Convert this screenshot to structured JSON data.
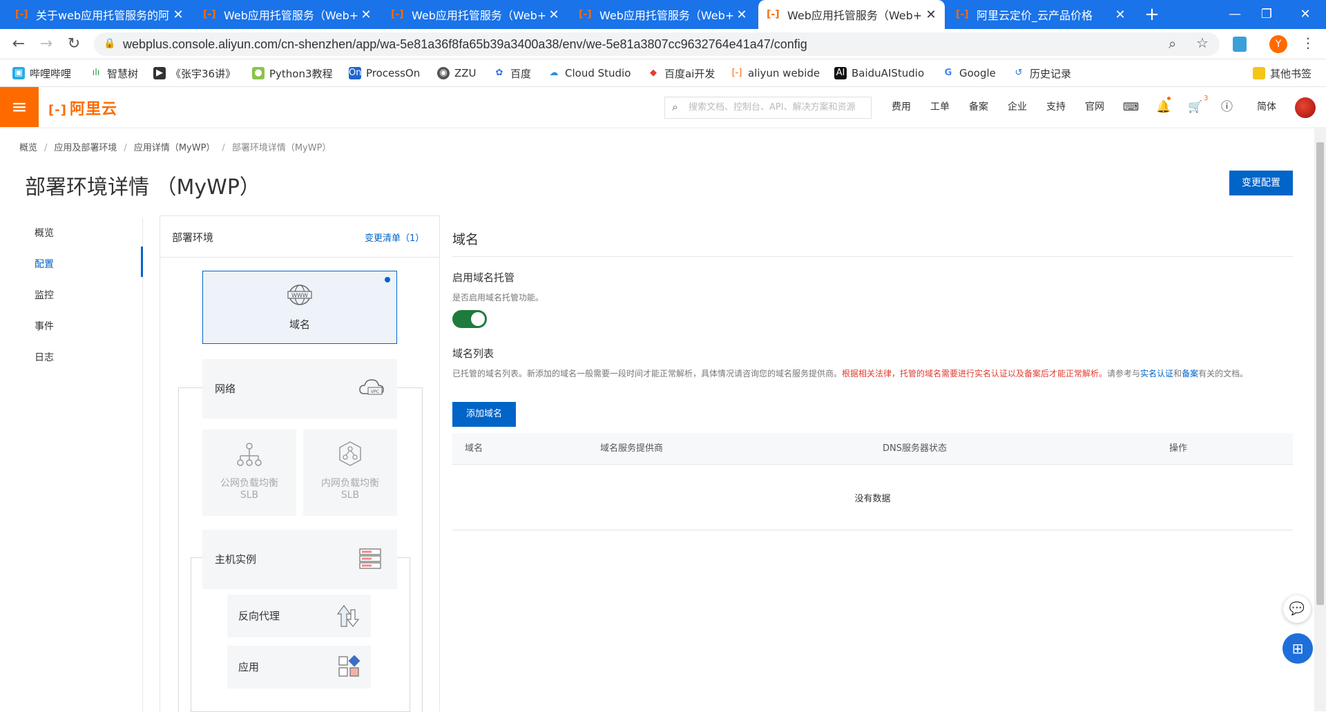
{
  "browser": {
    "tabs": [
      {
        "title": "关于web应用托管服务的阿里",
        "active": false
      },
      {
        "title": "Web应用托管服务（Web+）",
        "active": false
      },
      {
        "title": "Web应用托管服务（Web+）",
        "active": false
      },
      {
        "title": "Web应用托管服务（Web+）",
        "active": false
      },
      {
        "title": "Web应用托管服务（Web+）",
        "active": true
      },
      {
        "title": "阿里云定价_云产品价格",
        "active": false
      }
    ],
    "url": "webplus.console.aliyun.com/cn-shenzhen/app/wa-5e81a36f8fa65b39a3400a38/env/we-5e81a3807cc9632764e41a47/config",
    "profile_initial": "Y",
    "bookmarks": [
      "哔哩哔哩",
      "智慧树",
      "《张宇36讲》",
      "Python3教程",
      "ProcessOn",
      "ZZU",
      "百度",
      "Cloud Studio",
      "百度ai开发",
      "aliyun webide",
      "BaiduAIStudio",
      "Google",
      "历史记录"
    ],
    "other_bookmarks": "其他书签"
  },
  "header": {
    "logo": "阿里云",
    "search_placeholder": "搜索文档、控制台、API、解决方案和资源",
    "nav": [
      "费用",
      "工单",
      "备案",
      "企业",
      "支持",
      "官网"
    ],
    "cart_badge": "3",
    "lang": "简体"
  },
  "breadcrumb": [
    "概览",
    "应用及部署环境",
    "应用详情（MyWP）",
    "部署环境详情（MyWP）"
  ],
  "page_title": "部署环境详情 （MyWP）",
  "change_config_button": "变更配置",
  "left_menu": [
    "概览",
    "配置",
    "监控",
    "事件",
    "日志"
  ],
  "env_panel": {
    "title": "部署环境",
    "change_list": "变更清单（1）",
    "cards": {
      "domain": "域名",
      "network": "网络",
      "public_slb_line1": "公网负载均衡",
      "public_slb_line2": "SLB",
      "private_slb_line1": "内网负载均衡",
      "private_slb_line2": "SLB",
      "host": "主机实例",
      "proxy": "反向代理",
      "app": "应用"
    },
    "icon_texts": {
      "www": "WWW",
      "vpc": "VPC"
    }
  },
  "domain_section": {
    "title": "域名",
    "hosting_title": "启用域名托管",
    "hosting_desc": "是否启用域名托管功能。",
    "hosting_enabled": true,
    "list_title": "域名列表",
    "list_desc_1": "已托管的域名列表。新添加的域名一般需要一段时间才能正常解析，具体情况请咨询您的域名服务提供商。",
    "list_desc_red": "根据相关法律，托管的域名需要进行实名认证以及备案后才能正常解析。",
    "list_desc_2": "请参考与",
    "link_1": "实名认证",
    "and": "和",
    "link_2": "备案",
    "list_desc_3": "有关的文档。",
    "add_button": "添加域名",
    "columns": [
      "域名",
      "域名服务提供商",
      "DNS服务器状态",
      "操作"
    ],
    "empty_text": "没有数据"
  }
}
